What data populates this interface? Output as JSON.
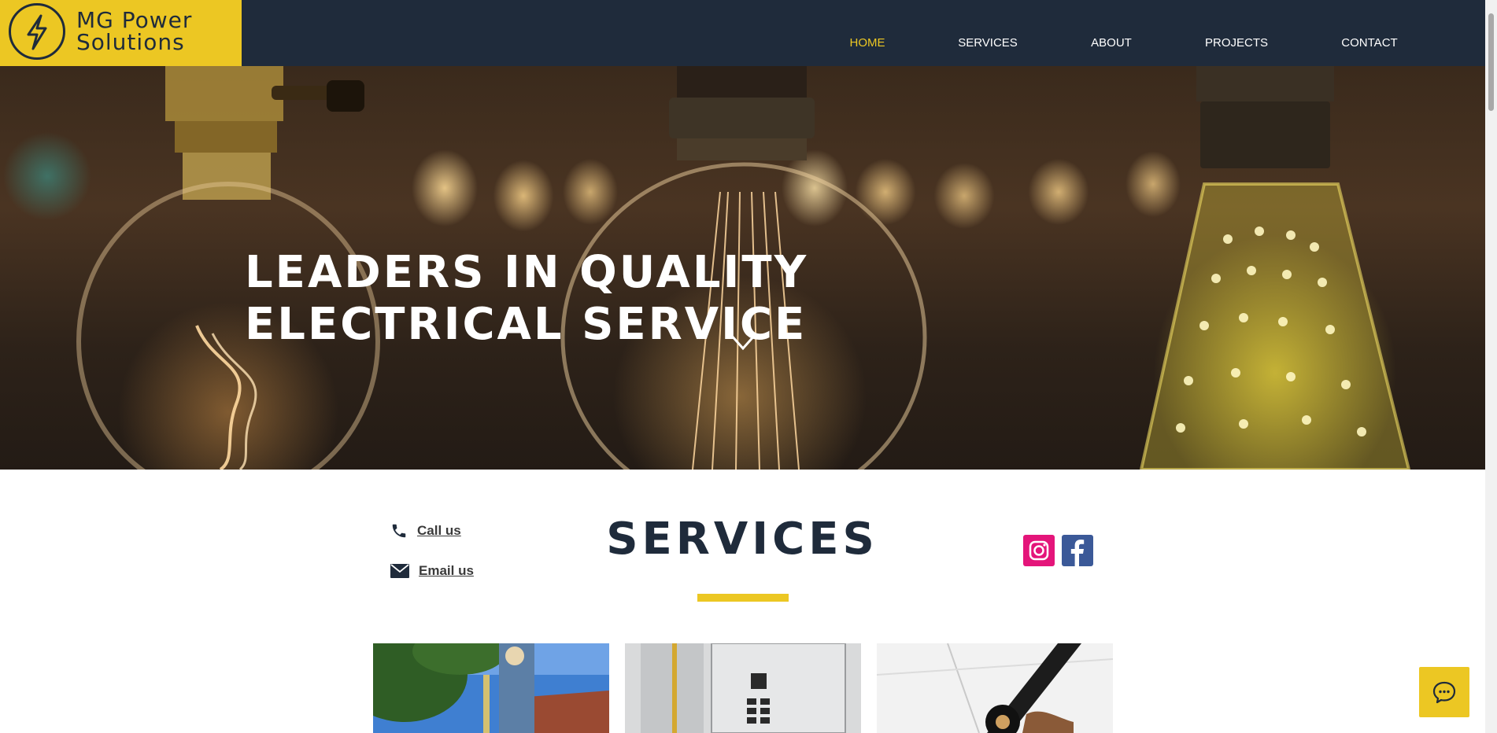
{
  "brand": {
    "name_line1": "MG Power",
    "name_line2": "Solutions",
    "logo_icon": "lightning-bolt-icon",
    "accent_color": "#ecc723",
    "dark_color": "#1f2b3b"
  },
  "nav": {
    "items": [
      {
        "label": "HOME",
        "active": true
      },
      {
        "label": "SERVICES",
        "active": false
      },
      {
        "label": "ABOUT",
        "active": false
      },
      {
        "label": "PROJECTS",
        "active": false
      },
      {
        "label": "CONTACT",
        "active": false
      }
    ]
  },
  "hero": {
    "title_line1": "LEADERS IN QUALITY",
    "title_line2": "ELECTRICAL SERVICE",
    "scroll_icon": "chevron-down-icon"
  },
  "contact": {
    "call_label": "Call us",
    "email_label": "Email us",
    "phone_icon": "phone-icon",
    "mail_icon": "mail-icon"
  },
  "services": {
    "title": "SERVICES"
  },
  "social": {
    "instagram_icon": "instagram-icon",
    "facebook_icon": "facebook-icon",
    "instagram_color": "#e4157a",
    "facebook_color": "#3b5998"
  },
  "chat": {
    "icon": "chat-icon"
  }
}
